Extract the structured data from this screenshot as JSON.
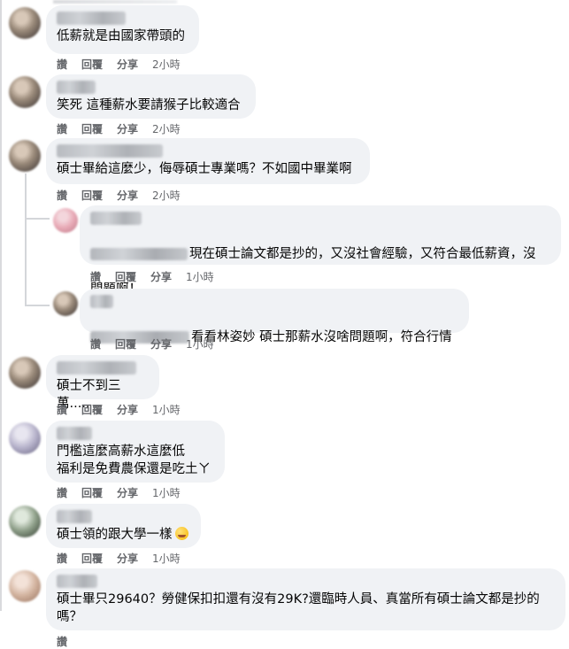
{
  "actions": {
    "like": "讚",
    "reply": "回覆",
    "share": "分享"
  },
  "comments": [
    {
      "text": "低薪就是由國家帶頭的",
      "time": "2小時"
    },
    {
      "text": "笑死 這種薪水要請猴子比較適合",
      "time": "2小時"
    },
    {
      "text": "碩士畢給這麼少，侮辱碩士專業嗎？不如國中畢業啊",
      "time": "2小時"
    },
    {
      "text_line1": "現在碩士論文都是抄的，又沒社會經驗，又符合最低薪資，沒",
      "text_line2": "問題啊！",
      "time": "1小時"
    },
    {
      "text": "看看林姿妙 碩士那薪水沒啥問題啊，符合行情",
      "time": "1小時"
    },
    {
      "text": "碩士不到三萬.....",
      "time": "1小時"
    },
    {
      "text": "門檻這麼高薪水這麼低\n福利是免費農保還是吃土ㄚ",
      "time": "1小時"
    },
    {
      "text": "碩士領的跟大學一樣",
      "emoji": "rolling-on-floor-laughing-emoji",
      "time": "1小時"
    },
    {
      "text": "碩士畢只29640？勞健保扣扣還有沒有29K?還臨時人員、真當所有碩士論文都是抄的\n嗎？"
    }
  ]
}
